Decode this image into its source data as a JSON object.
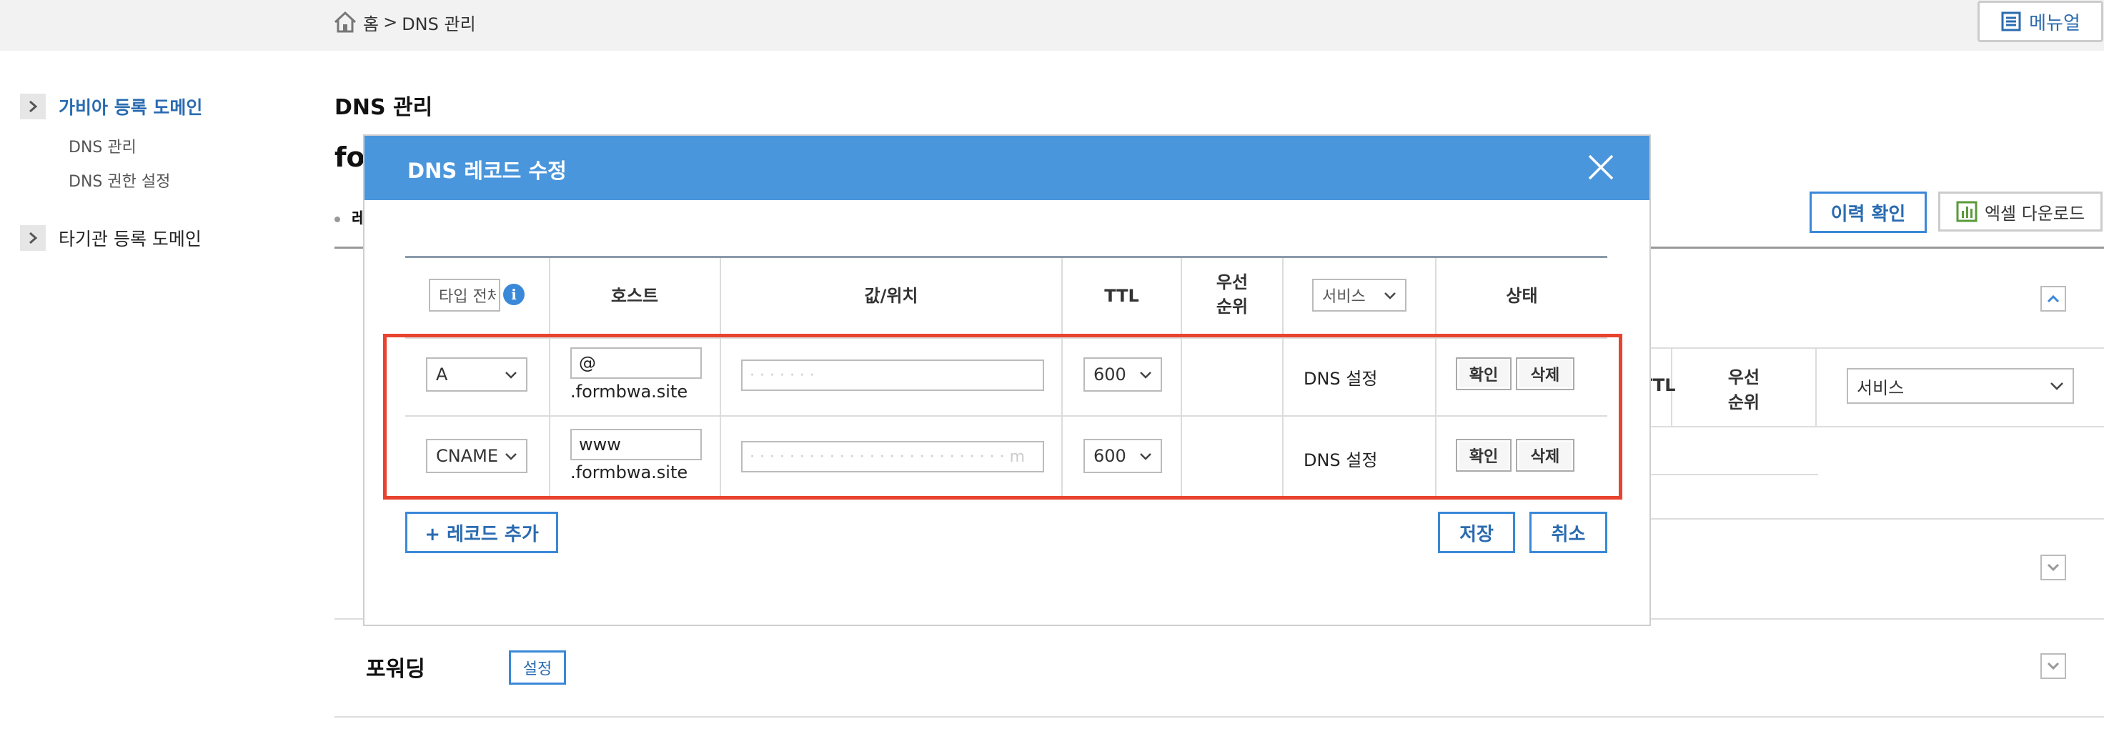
{
  "breadcrumb": {
    "home": "홈",
    "separator": ">",
    "current": "DNS 관리"
  },
  "header": {
    "manual_label": "메뉴얼"
  },
  "sidebar": {
    "groups": [
      {
        "label": "가비아 등록 도메인",
        "active": true,
        "items": [
          "DNS 관리",
          "DNS 권한 설정"
        ]
      },
      {
        "label": "타기관 등록 도메인",
        "active": false,
        "items": []
      }
    ]
  },
  "main": {
    "page_title": "DNS 관리",
    "domain_title_partial": "fo",
    "tab_partial": "레",
    "history_button": "이력 확인",
    "excel_button": "엑셀 다운로드",
    "background_table": {
      "ttl_header": "TTL",
      "priority_header": "우선\n순위",
      "service_select": "서비스"
    },
    "forwarding": {
      "title": "포워딩",
      "setting_button": "설정"
    }
  },
  "modal": {
    "title": "DNS 레코드 수정",
    "headers": {
      "type_filter": "타입 전체",
      "host": "호스트",
      "value": "값/위치",
      "ttl": "TTL",
      "priority": "우선\n순위",
      "service_select": "서비스",
      "status": "상태"
    },
    "records": [
      {
        "type": "A",
        "host": "@",
        "host_suffix": ".formbwa.site",
        "value": "· · · · · · ·",
        "ttl": "600",
        "priority": "",
        "service": "DNS 설정",
        "confirm": "확인",
        "delete": "삭제"
      },
      {
        "type": "CNAME",
        "host": "www",
        "host_suffix": ".formbwa.site",
        "value": "· · · · · · · · · · · · · · · · · · · · · · · · · · m",
        "ttl": "600",
        "priority": "",
        "service": "DNS 설정",
        "confirm": "확인",
        "delete": "삭제"
      }
    ],
    "add_record_button": "+ 레코드 추가",
    "save_button": "저장",
    "cancel_button": "취소"
  },
  "colors": {
    "accent": "#4a96dc",
    "highlight": "#e8432e",
    "link": "#2a6bb0"
  }
}
